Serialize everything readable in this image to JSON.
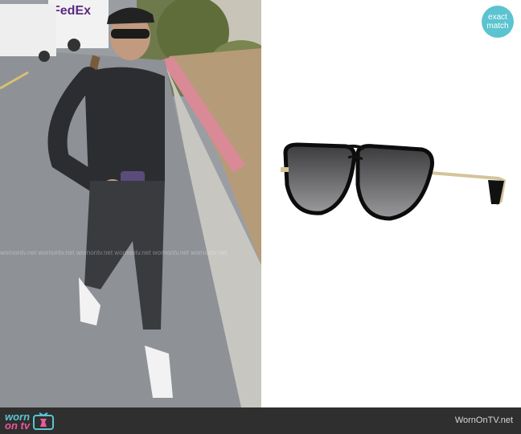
{
  "photo": {
    "truck_text": "FedEx",
    "watermark": "wornontv.net wornontv.net wornontv.net wornontv.net wornontv.net wornontv.net"
  },
  "badge": {
    "line1": "exact",
    "line2": "match",
    "color": "#5bc4d0"
  },
  "footer": {
    "logo_top": "worn",
    "logo_bottom": "on tv",
    "logo_icon": "tv-icon",
    "site": "WornOnTV.net",
    "background": "#2f2f2f"
  },
  "product": {
    "icon": "aviator-sunglasses"
  }
}
